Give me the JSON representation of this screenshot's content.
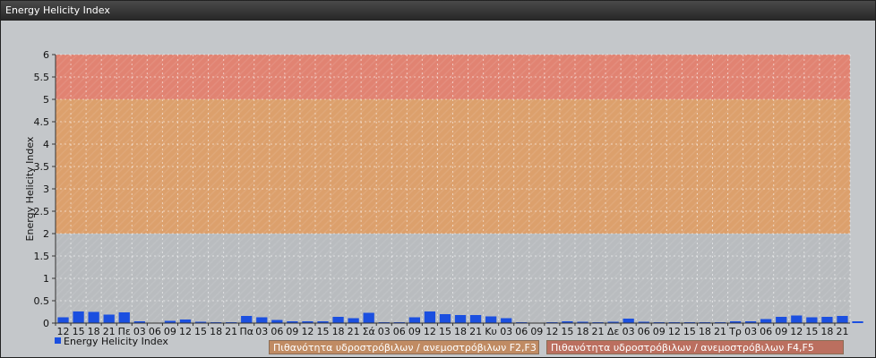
{
  "window": {
    "title": "Energy Helicity Index"
  },
  "legend": {
    "series_label": "Energy Helicity Index",
    "band_f2f3": "Πιθανότητα υδροστρόβιλων / ανεμοστρόβιλων F2,F3",
    "band_f4f5": "Πιθανότητα υδροστρόβιλων / ανεμοστρόβιλων F4,F5"
  },
  "chart_data": {
    "type": "bar",
    "title": "",
    "xlabel": "",
    "ylabel": "Energy Helicity Index",
    "ylim": [
      0,
      6
    ],
    "yticks": [
      0,
      0.5,
      1,
      1.5,
      2,
      2.5,
      3,
      3.5,
      4,
      4.5,
      5,
      5.5,
      6
    ],
    "grid": true,
    "legend_position": "bottom-left",
    "colors": {
      "bar": "#1b4fe0",
      "band_low": "#b9bcbf",
      "band_mid": "#dca06c",
      "band_high": "#e18372"
    },
    "bands": [
      {
        "from": 0,
        "to": 2,
        "color": "#b9bcbf"
      },
      {
        "from": 2,
        "to": 5,
        "color": "#dca06c",
        "label": "Πιθανότητα υδροστρόβιλων / ανεμοστρόβιλων F2,F3"
      },
      {
        "from": 5,
        "to": 6,
        "color": "#e18372",
        "label": "Πιθανότητα υδροστρόβιλων / ανεμοστρόβιλων F4,F5"
      }
    ],
    "categories": [
      "12",
      "15",
      "18",
      "21",
      "Πε",
      "03",
      "06",
      "09",
      "12",
      "15",
      "18",
      "21",
      "Πα",
      "03",
      "06",
      "09",
      "12",
      "15",
      "18",
      "21",
      "Σά",
      "03",
      "06",
      "09",
      "12",
      "15",
      "18",
      "21",
      "Κυ",
      "03",
      "06",
      "09",
      "12",
      "15",
      "18",
      "21",
      "Δε",
      "03",
      "06",
      "09",
      "12",
      "15",
      "18",
      "21",
      "Τρ",
      "03",
      "06",
      "09",
      "12",
      "15",
      "18",
      "21"
    ],
    "series": [
      {
        "name": "Energy Helicity Index",
        "values": [
          0.13,
          0.26,
          0.25,
          0.19,
          0.24,
          0.04,
          0.01,
          0.05,
          0.08,
          0.03,
          0.02,
          0.02,
          0.16,
          0.13,
          0.07,
          0.04,
          0.04,
          0.04,
          0.14,
          0.11,
          0.23,
          0.02,
          0.02,
          0.13,
          0.26,
          0.2,
          0.18,
          0.18,
          0.15,
          0.11,
          0.02,
          0.01,
          0.02,
          0.04,
          0.03,
          0.02,
          0.03,
          0.1,
          0.03,
          0.02,
          0.02,
          0.02,
          0.02,
          0.02,
          0.04,
          0.04,
          0.09,
          0.14,
          0.17,
          0.13,
          0.14,
          0.16,
          0.04
        ]
      }
    ]
  }
}
